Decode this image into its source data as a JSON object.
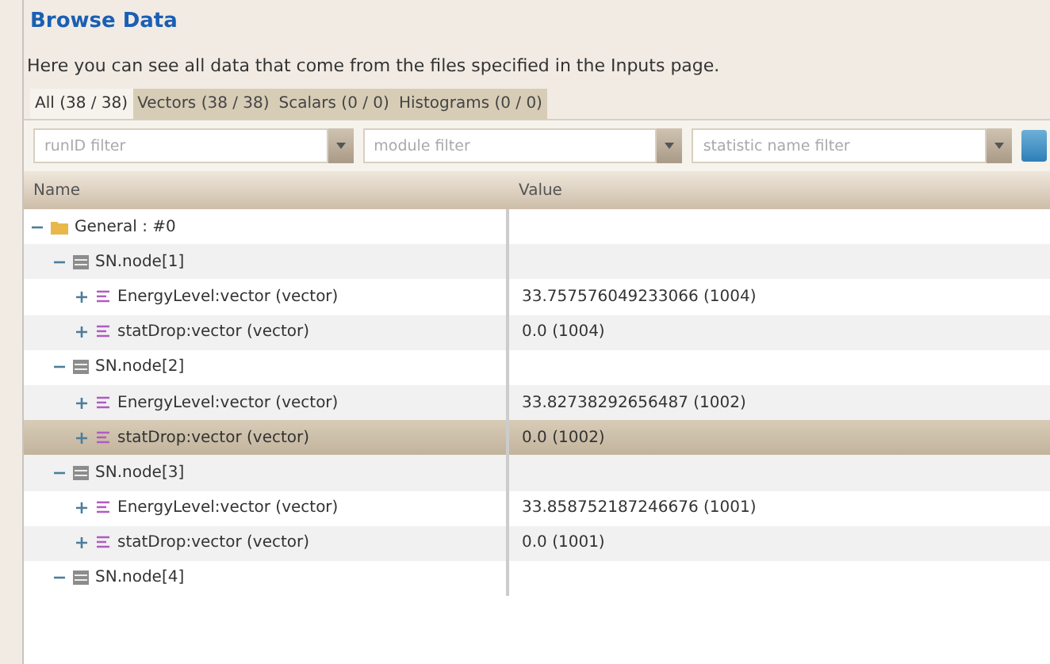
{
  "title": "Browse Data",
  "description": "Here you can see all data that come from the files specified in the Inputs page.",
  "tabs": [
    {
      "label": "All (38 / 38)",
      "selected": true
    },
    {
      "label": "Vectors (38 / 38)",
      "selected": false
    },
    {
      "label": "Scalars (0 / 0)",
      "selected": false
    },
    {
      "label": "Histograms (0 / 0)",
      "selected": false
    }
  ],
  "filters": [
    {
      "placeholder": "runID filter"
    },
    {
      "placeholder": "module filter"
    },
    {
      "placeholder": "statistic name filter"
    }
  ],
  "tree": {
    "columns": [
      "Name",
      "Value"
    ],
    "rows": [
      {
        "kind": "folder",
        "label": "General : #0",
        "expanded": true,
        "selected": false,
        "children": [
          {
            "kind": "module",
            "label": "SN.node[1]",
            "expanded": true,
            "selected": false,
            "children": [
              {
                "kind": "vector",
                "label": "EnergyLevel:vector (vector)",
                "value": "33.757576049233066 (1004)",
                "expanded": false,
                "selected": false
              },
              {
                "kind": "vector",
                "label": "statDrop:vector (vector)",
                "value": "0.0 (1004)",
                "expanded": false,
                "selected": false
              }
            ]
          },
          {
            "kind": "module",
            "label": "SN.node[2]",
            "expanded": true,
            "selected": false,
            "children": [
              {
                "kind": "vector",
                "label": "EnergyLevel:vector (vector)",
                "value": "33.82738292656487 (1002)",
                "expanded": false,
                "selected": false
              },
              {
                "kind": "vector",
                "label": "statDrop:vector (vector)",
                "value": "0.0 (1002)",
                "expanded": false,
                "selected": true
              }
            ]
          },
          {
            "kind": "module",
            "label": "SN.node[3]",
            "expanded": true,
            "selected": false,
            "children": [
              {
                "kind": "vector",
                "label": "EnergyLevel:vector (vector)",
                "value": "33.858752187246676 (1001)",
                "expanded": false,
                "selected": false
              },
              {
                "kind": "vector",
                "label": "statDrop:vector (vector)",
                "value": "0.0 (1001)",
                "expanded": false,
                "selected": false
              }
            ]
          },
          {
            "kind": "module",
            "label": "SN.node[4]",
            "expanded": true,
            "selected": false
          }
        ]
      }
    ]
  }
}
